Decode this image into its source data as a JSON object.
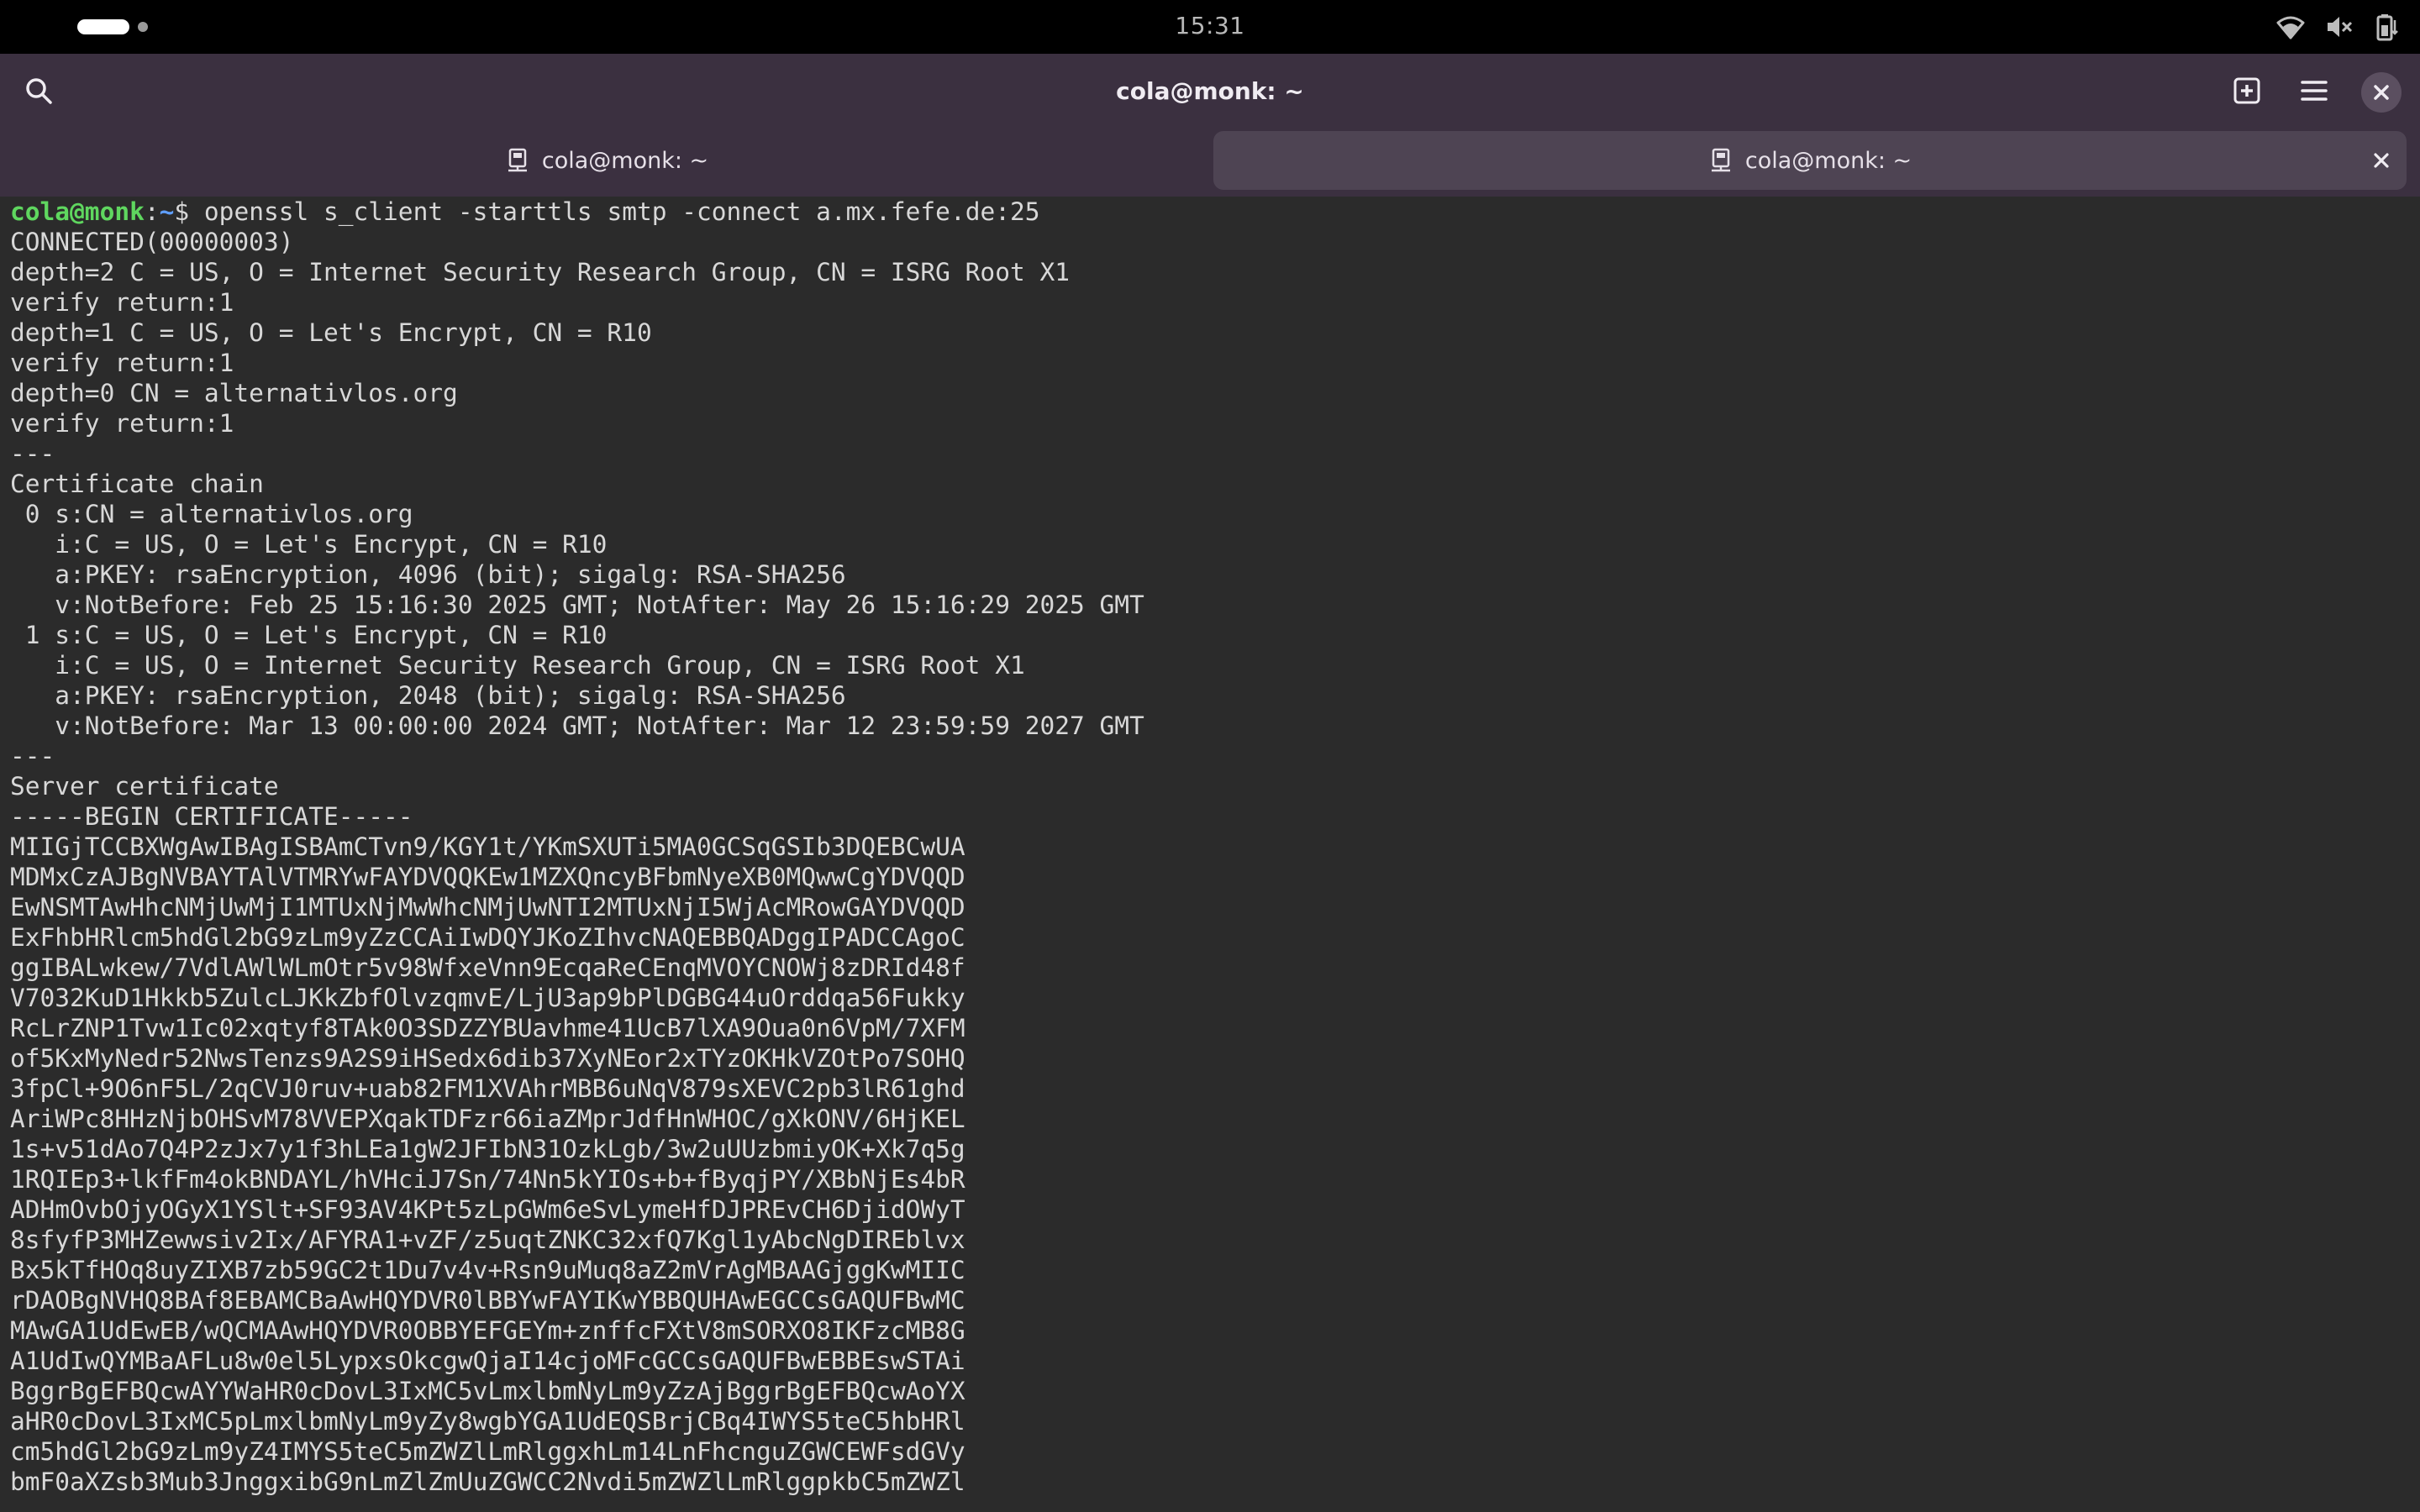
{
  "status_bar": {
    "time": "15:31",
    "icons": [
      "wifi-icon",
      "volume-muted-icon",
      "battery-icon"
    ]
  },
  "header": {
    "title": "cola@monk: ~",
    "icons": [
      "search-icon",
      "new-tab-icon",
      "menu-icon",
      "close-icon"
    ]
  },
  "tabs": [
    {
      "label": "cola@monk: ~",
      "active": false
    },
    {
      "label": "cola@monk: ~",
      "active": true
    }
  ],
  "terminal": {
    "prompt_user": "cola@monk",
    "prompt_sep": ":",
    "prompt_path": "~",
    "prompt_symbol": "$ ",
    "command": "openssl s_client -starttls smtp -connect a.mx.fefe.de:25",
    "output": [
      "CONNECTED(00000003)",
      "depth=2 C = US, O = Internet Security Research Group, CN = ISRG Root X1",
      "verify return:1",
      "depth=1 C = US, O = Let's Encrypt, CN = R10",
      "verify return:1",
      "depth=0 CN = alternativlos.org",
      "verify return:1",
      "---",
      "Certificate chain",
      " 0 s:CN = alternativlos.org",
      "   i:C = US, O = Let's Encrypt, CN = R10",
      "   a:PKEY: rsaEncryption, 4096 (bit); sigalg: RSA-SHA256",
      "   v:NotBefore: Feb 25 15:16:30 2025 GMT; NotAfter: May 26 15:16:29 2025 GMT",
      " 1 s:C = US, O = Let's Encrypt, CN = R10",
      "   i:C = US, O = Internet Security Research Group, CN = ISRG Root X1",
      "   a:PKEY: rsaEncryption, 2048 (bit); sigalg: RSA-SHA256",
      "   v:NotBefore: Mar 13 00:00:00 2024 GMT; NotAfter: Mar 12 23:59:59 2027 GMT",
      "---",
      "Server certificate",
      "-----BEGIN CERTIFICATE-----",
      "MIIGjTCCBXWgAwIBAgISBAmCTvn9/KGY1t/YKmSXUTi5MA0GCSqGSIb3DQEBCwUA",
      "MDMxCzAJBgNVBAYTAlVTMRYwFAYDVQQKEw1MZXQncyBFbmNyeXB0MQwwCgYDVQQD",
      "EwNSMTAwHhcNMjUwMjI1MTUxNjMwWhcNMjUwNTI2MTUxNjI5WjAcMRowGAYDVQQD",
      "ExFhbHRlcm5hdGl2bG9zLm9yZzCCAiIwDQYJKoZIhvcNAQEBBQADggIPADCCAgoC",
      "ggIBALwkew/7VdlAWlWLmOtr5v98WfxeVnn9EcqaReCEnqMVOYCNOWj8zDRId48f",
      "V7032KuD1Hkkb5ZulcLJKkZbfOlvzqmvE/LjU3ap9bPlDGBG44uOrddqa56Fukky",
      "RcLrZNP1Tvw1Ic02xqtyf8TAk0O3SDZZYBUavhme41UcB7lXA9Oua0n6VpM/7XFM",
      "of5KxMyNedr52NwsTenzs9A2S9iHSedx6dib37XyNEor2xTYzOKHkVZOtPo7SOHQ",
      "3fpCl+9O6nF5L/2qCVJ0ruv+uab82FM1XVAhrMBB6uNqV879sXEVC2pb3lR61ghd",
      "AriWPc8HHzNjbOHSvM78VVEPXqakTDFzr66iaZMprJdfHnWHOC/gXkONV/6HjKEL",
      "1s+v51dAo7Q4P2zJx7y1f3hLEa1gW2JFIbN31OzkLgb/3w2uUUzbmiyOK+Xk7q5g",
      "1RQIEp3+lkfFm4okBNDAYL/hVHciJ7Sn/74Nn5kYIOs+b+fByqjPY/XBbNjEs4bR",
      "ADHmOvbOjyOGyX1YSlt+SF93AV4KPt5zLpGWm6eSvLymeHfDJPREvCH6DjidOWyT",
      "8sfyfP3MHZewwsiv2Ix/AFYRA1+vZF/z5uqtZNKC32xfQ7Kgl1yAbcNgDIREblvx",
      "Bx5kTfHOq8uyZIXB7zb59GC2t1Du7v4v+Rsn9uMuq8aZ2mVrAgMBAAGjggKwMIIC",
      "rDAOBgNVHQ8BAf8EBAMCBaAwHQYDVR0lBBYwFAYIKwYBBQUHAwEGCCsGAQUFBwMC",
      "MAwGA1UdEwEB/wQCMAAwHQYDVR0OBBYEFGEYm+znffcFXtV8mSORXO8IKFzcMB8G",
      "A1UdIwQYMBaAFLu8w0el5LypxsOkcgwQjaI14cjoMFcGCCsGAQUFBwEBBEswSTAi",
      "BggrBgEFBQcwAYYWaHR0cDovL3IxMC5vLmxlbmNyLm9yZzAjBggrBgEFBQcwAoYX",
      "aHR0cDovL3IxMC5pLmxlbmNyLm9yZy8wgbYGA1UdEQSBrjCBq4IWYS5teC5hbHRl",
      "cm5hdGl2bG9zLm9yZ4IMYS5teC5mZWZlLmRlggxhLm14LnFhcnguZGWCEWFsdGVy",
      "bmF0aXZsb3Mub3JnggxibG9nLmZlZmUuZGWCC2Nvdi5mZWZlLmRlggpkbC5mZWZl"
    ]
  }
}
